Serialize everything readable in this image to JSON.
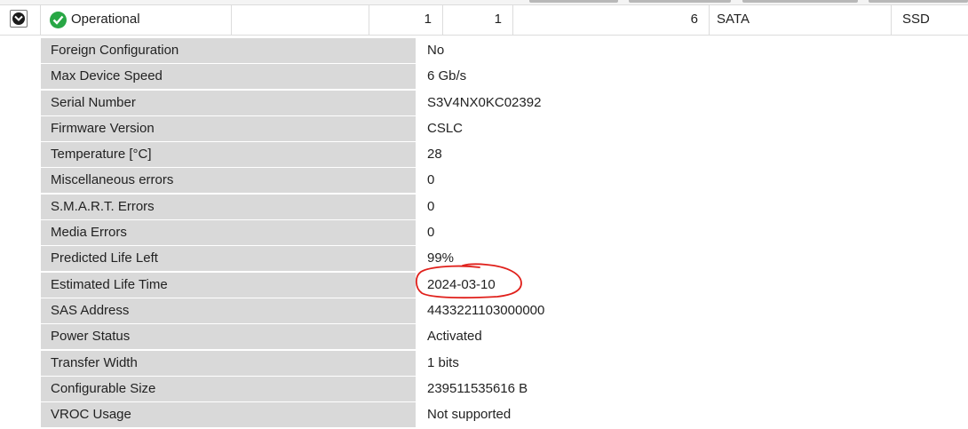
{
  "disk_row": {
    "status": "Operational",
    "col1": "1",
    "col2": "1",
    "col3": "6",
    "interface": "SATA",
    "media_type": "SSD"
  },
  "details": [
    {
      "label": "Foreign Configuration",
      "value": "No"
    },
    {
      "label": "Max Device Speed",
      "value": "6 Gb/s"
    },
    {
      "label": "Serial Number",
      "value": "S3V4NX0KC02392"
    },
    {
      "label": "Firmware Version",
      "value": "CSLC"
    },
    {
      "label": "Temperature [°C]",
      "value": "28"
    },
    {
      "label": "Miscellaneous errors",
      "value": "0"
    },
    {
      "label": "S.M.A.R.T. Errors",
      "value": "0"
    },
    {
      "label": "Media Errors",
      "value": "0"
    },
    {
      "label": "Predicted Life Left",
      "value": "99%"
    },
    {
      "label": "Estimated Life Time",
      "value": "2024-03-10"
    },
    {
      "label": "SAS Address",
      "value": "4433221103000000"
    },
    {
      "label": "Power Status",
      "value": "Activated"
    },
    {
      "label": "Transfer Width",
      "value": "1 bits"
    },
    {
      "label": "Configurable Size",
      "value": "239511535616 B"
    },
    {
      "label": "VROC Usage",
      "value": "Not supported"
    }
  ],
  "colors": {
    "status_ok": "#28a745",
    "label_bg": "#d9d9d9",
    "annotation": "#e0201b"
  },
  "icons": {
    "expand": "chevron-down-icon",
    "status": "check-circle-icon"
  }
}
